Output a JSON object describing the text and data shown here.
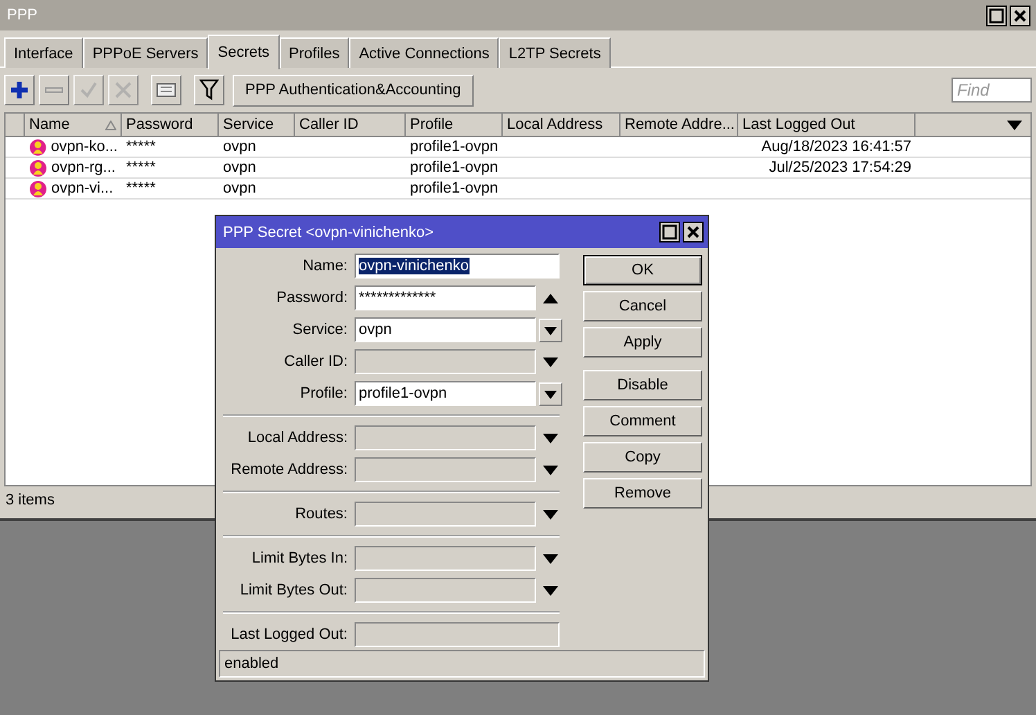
{
  "window": {
    "title": "PPP"
  },
  "tabs": [
    {
      "label": "Interface",
      "selected": false
    },
    {
      "label": "PPPoE Servers",
      "selected": false
    },
    {
      "label": "Secrets",
      "selected": true
    },
    {
      "label": "Profiles",
      "selected": false
    },
    {
      "label": "Active Connections",
      "selected": false
    },
    {
      "label": "L2TP Secrets",
      "selected": false
    }
  ],
  "toolbar": {
    "tools": [
      {
        "kind": "add",
        "disabled": false
      },
      {
        "kind": "remove",
        "disabled": false
      },
      {
        "kind": "enable",
        "disabled": true
      },
      {
        "kind": "disable",
        "disabled": true
      },
      {
        "kind": "comment",
        "disabled": false
      },
      {
        "kind": "filter",
        "disabled": false
      }
    ],
    "button": "PPP Authentication&Accounting",
    "search": {
      "placeholder": "Find"
    }
  },
  "table": {
    "columns": [
      "Name",
      "Password",
      "Service",
      "Caller ID",
      "Profile",
      "Local Address",
      "Remote Addre...",
      "Last Logged Out"
    ],
    "rows": [
      [
        "ovpn-ko...",
        "*****",
        "ovpn",
        "",
        "profile1-ovpn",
        "",
        "",
        "Aug/18/2023 16:41:57"
      ],
      [
        "ovpn-rg...",
        "*****",
        "ovpn",
        "",
        "profile1-ovpn",
        "",
        "",
        "Jul/25/2023 17:54:29"
      ],
      [
        "ovpn-vi...",
        "*****",
        "ovpn",
        "",
        "profile1-ovpn",
        "",
        "",
        ""
      ]
    ]
  },
  "status_bar": "3 items",
  "dialog": {
    "title": "PPP Secret <ovpn-vinichenko>",
    "groups": [
      [
        {
          "label": "Name:",
          "value": "ovpn-vinichenko",
          "kind": "text",
          "highlighted": true
        },
        {
          "label": "Password:",
          "value": "*************",
          "kind": "up"
        },
        {
          "label": "Service:",
          "value": "ovpn",
          "kind": "combo"
        },
        {
          "label": "Caller ID:",
          "kind": "down"
        },
        {
          "label": "Profile:",
          "value": "profile1-ovpn",
          "kind": "combo"
        }
      ],
      [
        {
          "label": "Local Address:",
          "kind": "down"
        },
        {
          "label": "Remote Address:",
          "kind": "down"
        }
      ],
      [
        {
          "label": "Routes:",
          "kind": "down"
        }
      ],
      [
        {
          "label": "Limit Bytes In:",
          "kind": "down"
        },
        {
          "label": "Limit Bytes Out:",
          "kind": "down"
        }
      ],
      [
        {
          "label": "Last Logged Out:",
          "kind": "readonly"
        }
      ]
    ],
    "buttons": [
      {
        "label": "OK",
        "default": true
      },
      {
        "label": "Cancel",
        "default": false
      },
      {
        "label": "Apply",
        "default": false
      },
      {
        "label": "Disable",
        "default": false
      },
      {
        "label": "Comment",
        "default": false
      },
      {
        "label": "Copy",
        "default": false
      },
      {
        "label": "Remove",
        "default": false
      }
    ],
    "status": "enabled"
  }
}
